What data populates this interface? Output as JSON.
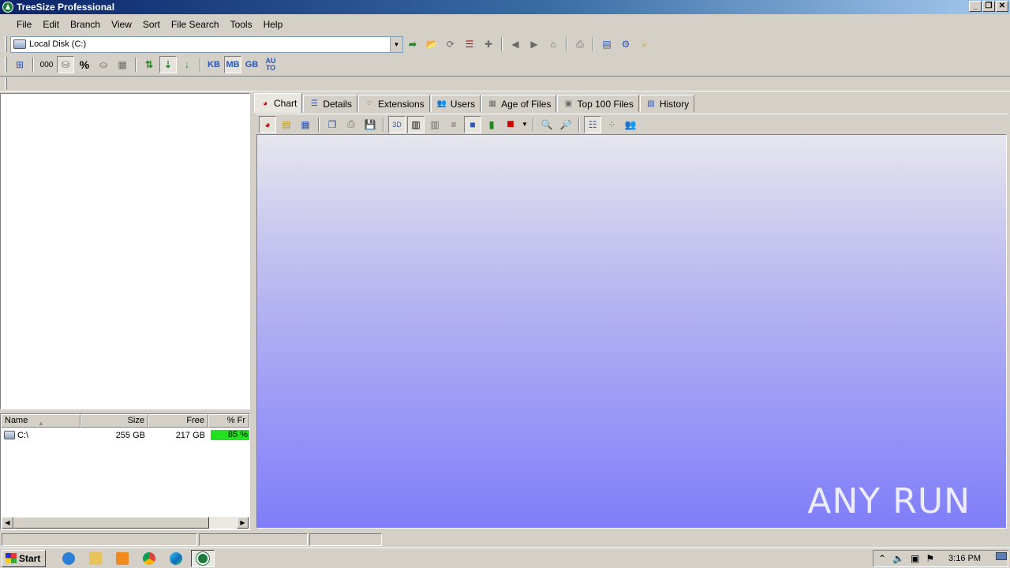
{
  "window": {
    "title": "TreeSize Professional",
    "buttons": [
      "_",
      "❐",
      "✕"
    ]
  },
  "menu": [
    "File",
    "Edit",
    "Branch",
    "View",
    "Sort",
    "File Search",
    "Tools",
    "Help"
  ],
  "drive_select": {
    "value": "Local Disk (C:)"
  },
  "units": {
    "kb": "KB",
    "mb": "MB",
    "gb": "GB",
    "auto": "AU\nTO"
  },
  "tabs": [
    "Chart",
    "Details",
    "Extensions",
    "Users",
    "Age of Files",
    "Top 100 Files",
    "History"
  ],
  "list": {
    "columns": [
      "Name",
      "Size",
      "Free",
      "% Fr"
    ],
    "rows": [
      {
        "name": "C:\\",
        "size": "255 GB",
        "free": "217 GB",
        "pct_free": "85 %",
        "pct_value": 0.85
      }
    ]
  },
  "colors": {
    "chart_top": "#e6e6ee",
    "chart_bottom": "#7f7ef9",
    "free_bar": "#23e023"
  },
  "watermark": "ANY RUN",
  "taskbar": {
    "start": "Start",
    "clock": "3:16 PM",
    "apps": [
      "internet-explorer",
      "file-explorer",
      "media-player",
      "chrome",
      "edge",
      "treesize"
    ]
  }
}
